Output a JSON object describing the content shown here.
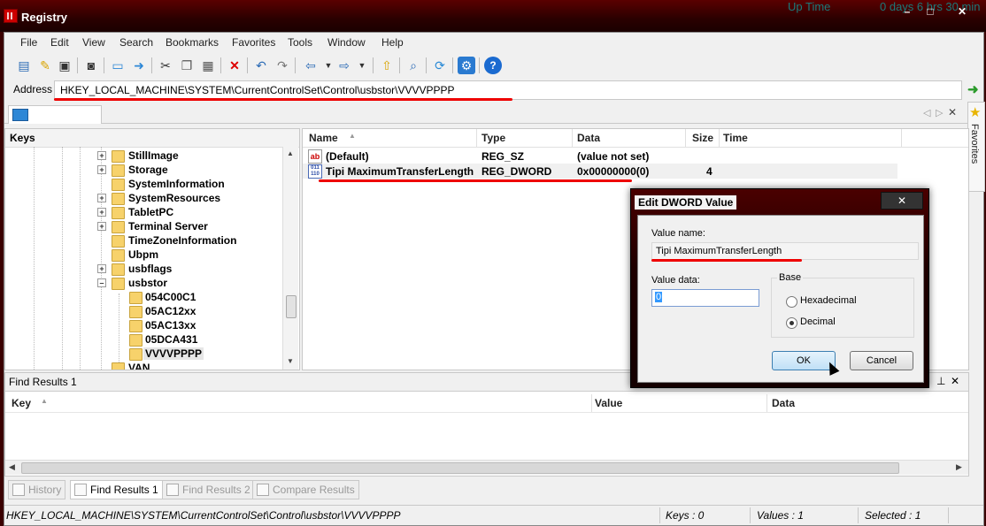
{
  "window": {
    "title": "Registry",
    "uptime_label": "Up Time",
    "uptime_value": "0 days 6 hrs 30 min",
    "controls": [
      "–",
      "□",
      "✕"
    ]
  },
  "menu": [
    "File",
    "Edit",
    "View",
    "Search",
    "Bookmarks",
    "Favorites",
    "Tools",
    "Window",
    "Help"
  ],
  "toolbar": {
    "icons": [
      "open-key-icon",
      "export-icon",
      "save-icon",
      "snapshot-icon",
      "computer-icon",
      "connect-icon",
      "cut-icon",
      "copy-icon",
      "paste-icon",
      "delete-icon",
      "undo-icon",
      "redo-icon",
      "back-icon",
      "forward-icon",
      "up-folder-icon",
      "find-icon",
      "refresh-icon",
      "settings-icon",
      "help-icon"
    ]
  },
  "address": {
    "label": "Address",
    "value": "HKEY_LOCAL_MACHINE\\SYSTEM\\CurrentControlSet\\Control\\usbstor\\VVVVPPPP"
  },
  "favorites_label": "Favorites",
  "keys": {
    "header": "Keys",
    "items": [
      {
        "label": "StillImage",
        "expandable": true,
        "level": 0
      },
      {
        "label": "Storage",
        "expandable": true,
        "level": 0
      },
      {
        "label": "SystemInformation",
        "expandable": false,
        "level": 0
      },
      {
        "label": "SystemResources",
        "expandable": true,
        "level": 0
      },
      {
        "label": "TabletPC",
        "expandable": true,
        "level": 0
      },
      {
        "label": "Terminal Server",
        "expandable": true,
        "level": 0
      },
      {
        "label": "TimeZoneInformation",
        "expandable": false,
        "level": 0
      },
      {
        "label": "Ubpm",
        "expandable": false,
        "level": 0
      },
      {
        "label": "usbflags",
        "expandable": true,
        "level": 0
      },
      {
        "label": "usbstor",
        "expandable": true,
        "level": 0
      },
      {
        "label": "054C00C1",
        "expandable": false,
        "level": 1
      },
      {
        "label": "05AC12xx",
        "expandable": false,
        "level": 1
      },
      {
        "label": "05AC13xx",
        "expandable": false,
        "level": 1
      },
      {
        "label": "05DCA431",
        "expandable": false,
        "level": 1
      },
      {
        "label": "VVVVPPPP",
        "expandable": false,
        "level": 1,
        "selected": true
      },
      {
        "label": "VAN",
        "expandable": false,
        "level": 0
      }
    ]
  },
  "values": {
    "columns": [
      "Name",
      "Type",
      "Data",
      "Size",
      "Time"
    ],
    "rows": [
      {
        "name": "(Default)",
        "type": "REG_SZ",
        "data": "(value not set)",
        "size": "",
        "time": "",
        "icon": "string-value-icon"
      },
      {
        "name": "Tipi MaximumTransferLength",
        "type": "REG_DWORD",
        "data": "0x00000000(0)",
        "size": "4",
        "time": "",
        "icon": "binary-value-icon"
      }
    ]
  },
  "find_results": {
    "title": "Find Results 1",
    "columns": [
      "Key",
      "Value",
      "Data"
    ]
  },
  "bottom_tabs": [
    {
      "label": "History",
      "active": false
    },
    {
      "label": "Find Results 1",
      "active": true
    },
    {
      "label": "Find Results 2",
      "active": false
    },
    {
      "label": "Compare Results",
      "active": false
    }
  ],
  "status": {
    "path": "HKEY_LOCAL_MACHINE\\SYSTEM\\CurrentControlSet\\Control\\usbstor\\VVVVPPPP",
    "keys": "Keys : 0",
    "values": "Values : 1",
    "selected": "Selected : 1"
  },
  "dialog": {
    "title": "Edit DWORD Value",
    "close": "✕",
    "value_name_label": "Value name:",
    "value_name": "Tipi MaximumTransferLength",
    "value_data_label": "Value data:",
    "value_data": "0",
    "base_label": "Base",
    "base_options": [
      {
        "label": "Hexadecimal",
        "selected": false
      },
      {
        "label": "Decimal",
        "selected": true
      }
    ],
    "ok": "OK",
    "cancel": "Cancel"
  },
  "colors": {
    "title_bar": "#3a0000",
    "underline_annotation": "#e00000",
    "selection_highlight": "#3399ff"
  }
}
